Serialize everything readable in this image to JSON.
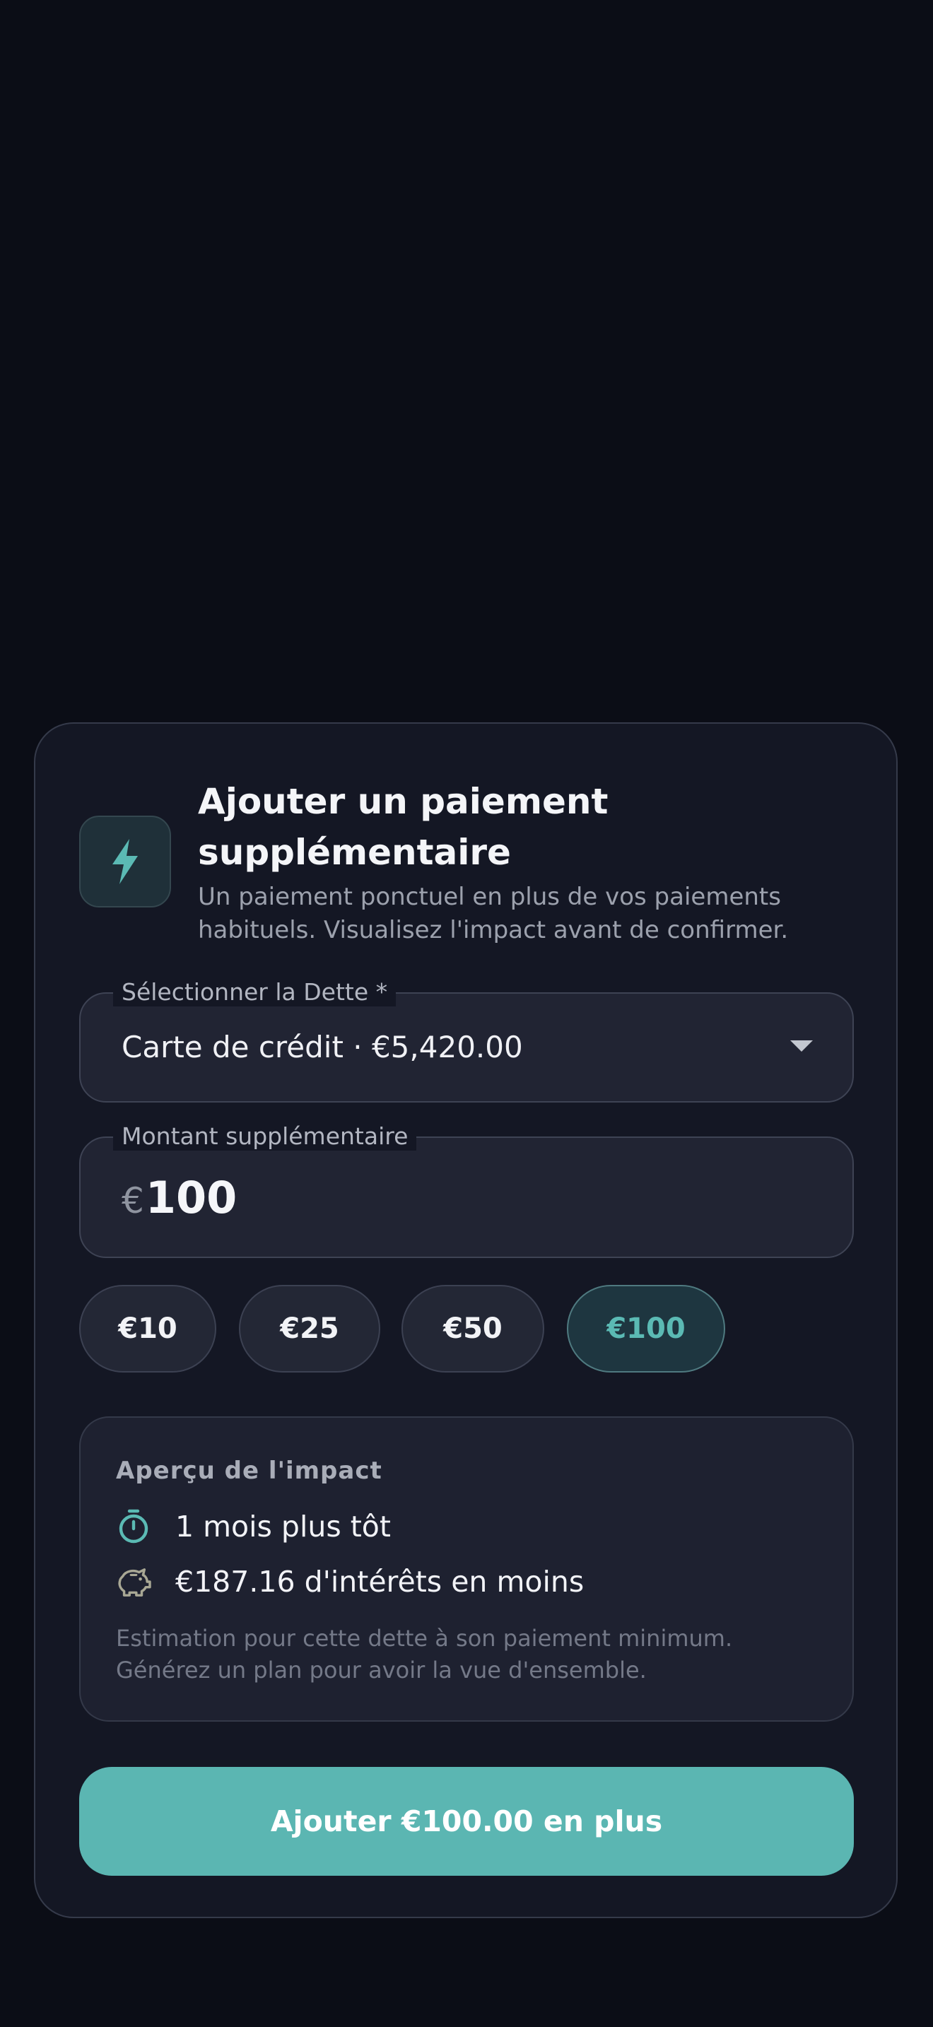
{
  "sheet": {
    "title": "Ajouter un paiement supplémentaire",
    "subtitle": "Un paiement ponctuel en plus de vos paiements habituels. Visualisez l'impact avant de confirmer.",
    "header_icon": "lightning-bolt-icon"
  },
  "debt_select": {
    "label": "Sélectionner la Dette *",
    "value": "Carte de crédit · €5,420.00"
  },
  "amount_field": {
    "label": "Montant supplémentaire",
    "currency_prefix": "€",
    "value": "100"
  },
  "quick_amounts": [
    {
      "label": "€10",
      "selected": false
    },
    {
      "label": "€25",
      "selected": false
    },
    {
      "label": "€50",
      "selected": false
    },
    {
      "label": "€100",
      "selected": true
    }
  ],
  "impact": {
    "title": "Aperçu de l'impact",
    "rows": [
      {
        "icon": "timer-icon",
        "text": "1 mois plus tôt"
      },
      {
        "icon": "piggy-bank-icon",
        "text": "€187.16 d'intérêts en moins"
      }
    ],
    "note": "Estimation pour cette dette à son paiement minimum. Générez un plan pour avoir la vue d'ensemble."
  },
  "submit_label": "Ajouter €100.00 en plus",
  "colors": {
    "background": "#0b0d16",
    "sheet": "#141724",
    "accent": "#5bb6b2",
    "text_primary": "#f2f3f7",
    "text_muted": "#9ca1ad"
  }
}
